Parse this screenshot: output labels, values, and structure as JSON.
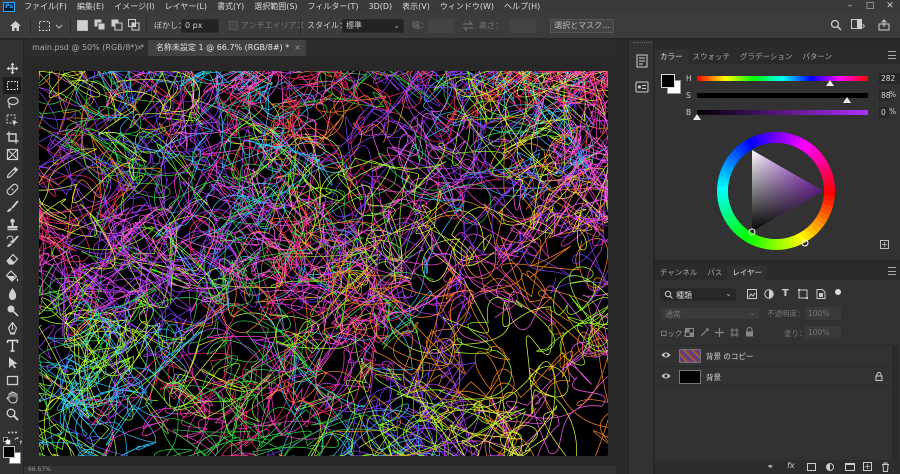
{
  "menubar": {
    "app_icon": "Ps",
    "items": [
      "ファイル(F)",
      "編集(E)",
      "イメージ(I)",
      "レイヤー(L)",
      "書式(Y)",
      "選択範囲(S)",
      "フィルター(T)",
      "3D(D)",
      "表示(V)",
      "ウィンドウ(W)",
      "ヘルプ(H)"
    ],
    "window_controls": [
      "minimize-icon",
      "maximize-icon",
      "close-icon"
    ]
  },
  "options": {
    "feather_label": "ぼかし：",
    "feather_value": "0 px",
    "antialias_label": "アンチエイリアス",
    "style_label": "スタイル：",
    "style_value": "標準",
    "width_label": "幅：",
    "height_label": "高さ：",
    "mask_button": "選択とマスク..."
  },
  "tabs": [
    {
      "label": "main.psd @ 50% (RGB/8*) *",
      "active": false
    },
    {
      "label": "名称未設定 1 @ 66.7% (RGB/8#) *",
      "active": true
    }
  ],
  "statusbar": {
    "zoom": "66.67%"
  },
  "color_panel": {
    "tabs": [
      "カラー",
      "スウォッチ",
      "グラデーション",
      "パターン"
    ],
    "channels": [
      {
        "name": "H",
        "value": "282",
        "unit": "",
        "thumb": 0.78
      },
      {
        "name": "S",
        "value": "88",
        "unit": "%",
        "thumb": 0.88
      },
      {
        "name": "B",
        "value": "0",
        "unit": "%",
        "thumb": 0.0
      }
    ],
    "fg_color": "#000000",
    "bg_color": "#ffffff",
    "wheel_hue_color": "#b030ff"
  },
  "layers_panel": {
    "tabs": [
      "チャンネル",
      "パス",
      "レイヤー"
    ],
    "filter_label": "種類",
    "blend_mode": "通常",
    "opacity_label": "不透明度：",
    "opacity_value": "100%",
    "lock_label": "ロック：",
    "fill_label": "塗り：",
    "fill_value": "100%",
    "layers": [
      {
        "name": "背景 のコピー",
        "thumb": "scribble",
        "locked": false
      },
      {
        "name": "背景",
        "thumb": "black",
        "locked": true
      }
    ]
  }
}
